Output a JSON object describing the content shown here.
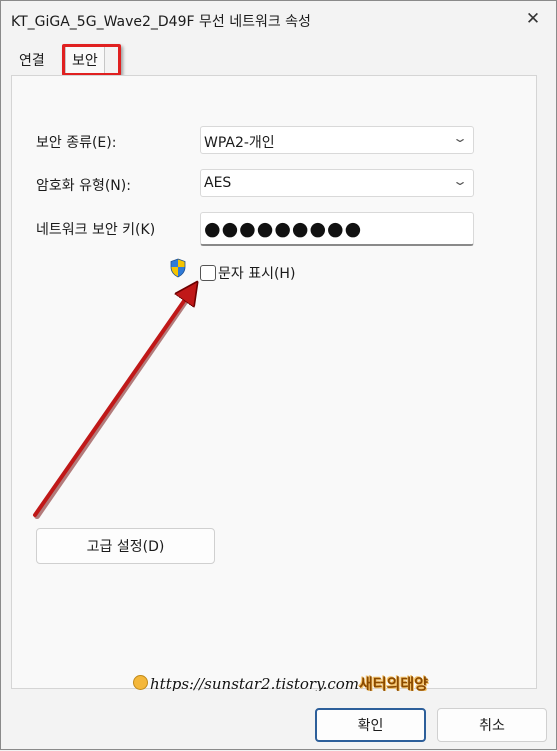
{
  "window": {
    "title": "KT_GiGA_5G_Wave2_D49F 무선 네트워크 속성",
    "close_glyph": "✕"
  },
  "tabs": [
    {
      "label": "연결",
      "selected": false
    },
    {
      "label": "보안",
      "selected": true
    }
  ],
  "security": {
    "type_label": "보안 종류(E):",
    "type_value": "WPA2-개인",
    "encryption_label": "암호화 유형(N):",
    "encryption_value": "AES",
    "key_label": "네트워크 보안 키(K)",
    "key_value": "●●●●●●●●●",
    "show_chars_label": "문자 표시(H)",
    "show_chars_checked": false,
    "advanced_button": "고급 설정(D)"
  },
  "watermark": {
    "url": "https://sunstar2.tistory.com",
    "brand": "새터의태양"
  },
  "footer": {
    "ok_label": "확인",
    "cancel_label": "취소"
  },
  "colors": {
    "highlight": "#e02020",
    "arrow": "#c01818",
    "shield_blue": "#2f7bd8",
    "shield_yellow": "#f5c400",
    "accent": "#2d5f9a"
  },
  "icons": [
    "close-icon",
    "chevron-down-icon",
    "uac-shield-icon",
    "smiley-icon"
  ]
}
